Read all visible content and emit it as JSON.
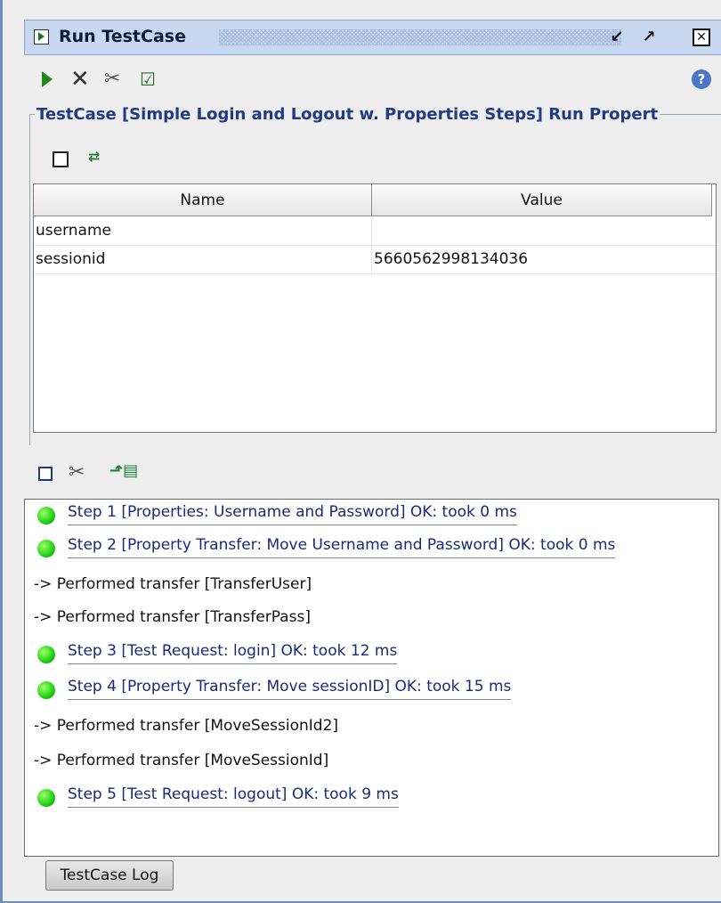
{
  "window": {
    "title": "Run TestCase"
  },
  "properties": {
    "group_title": "TestCase [Simple Login and Logout w. Properties Steps] Run Propert",
    "columns": [
      "Name",
      "Value"
    ],
    "rows": [
      {
        "name": "username",
        "value": ""
      },
      {
        "name": "sessionid",
        "value": "5660562998134036"
      }
    ]
  },
  "log": {
    "lines": [
      {
        "kind": "step",
        "status": "ok",
        "text": "Step 1 [Properties: Username and Password] OK: took 0 ms"
      },
      {
        "kind": "step",
        "status": "ok",
        "text": "Step 2 [Property Transfer: Move Username and Password] OK: took 0 ms"
      },
      {
        "kind": "info",
        "text": "-> Performed transfer [TransferUser]"
      },
      {
        "kind": "info",
        "text": "-> Performed transfer [TransferPass]"
      },
      {
        "kind": "step",
        "status": "ok",
        "text": "Step 3 [Test Request: login] OK: took 12 ms"
      },
      {
        "kind": "step",
        "status": "ok",
        "text": "Step 4 [Property Transfer: Move sessionID] OK: took 15 ms"
      },
      {
        "kind": "info",
        "text": "-> Performed transfer [MoveSessionId2]"
      },
      {
        "kind": "info",
        "text": "-> Performed transfer [MoveSessionId]"
      },
      {
        "kind": "step",
        "status": "ok",
        "text": "Step 5 [Test Request: logout] OK: took 9 ms"
      }
    ]
  },
  "bottom_tab": {
    "label": "TestCase Log"
  },
  "icons": {
    "title": "run-testcase-icon",
    "toolbar": [
      "run-icon",
      "cancel-icon",
      "options-icon",
      "check-icon",
      "help-icon"
    ],
    "props_toolbar": [
      "checkbox-icon",
      "transfer-icon"
    ],
    "log_toolbar": [
      "clear-icon",
      "options-icon",
      "export-icon"
    ]
  },
  "colors": {
    "accent": "#c8d8f1",
    "ok": "#1fcf12",
    "link": "#1a2a7a",
    "group_title": "#203a84"
  }
}
